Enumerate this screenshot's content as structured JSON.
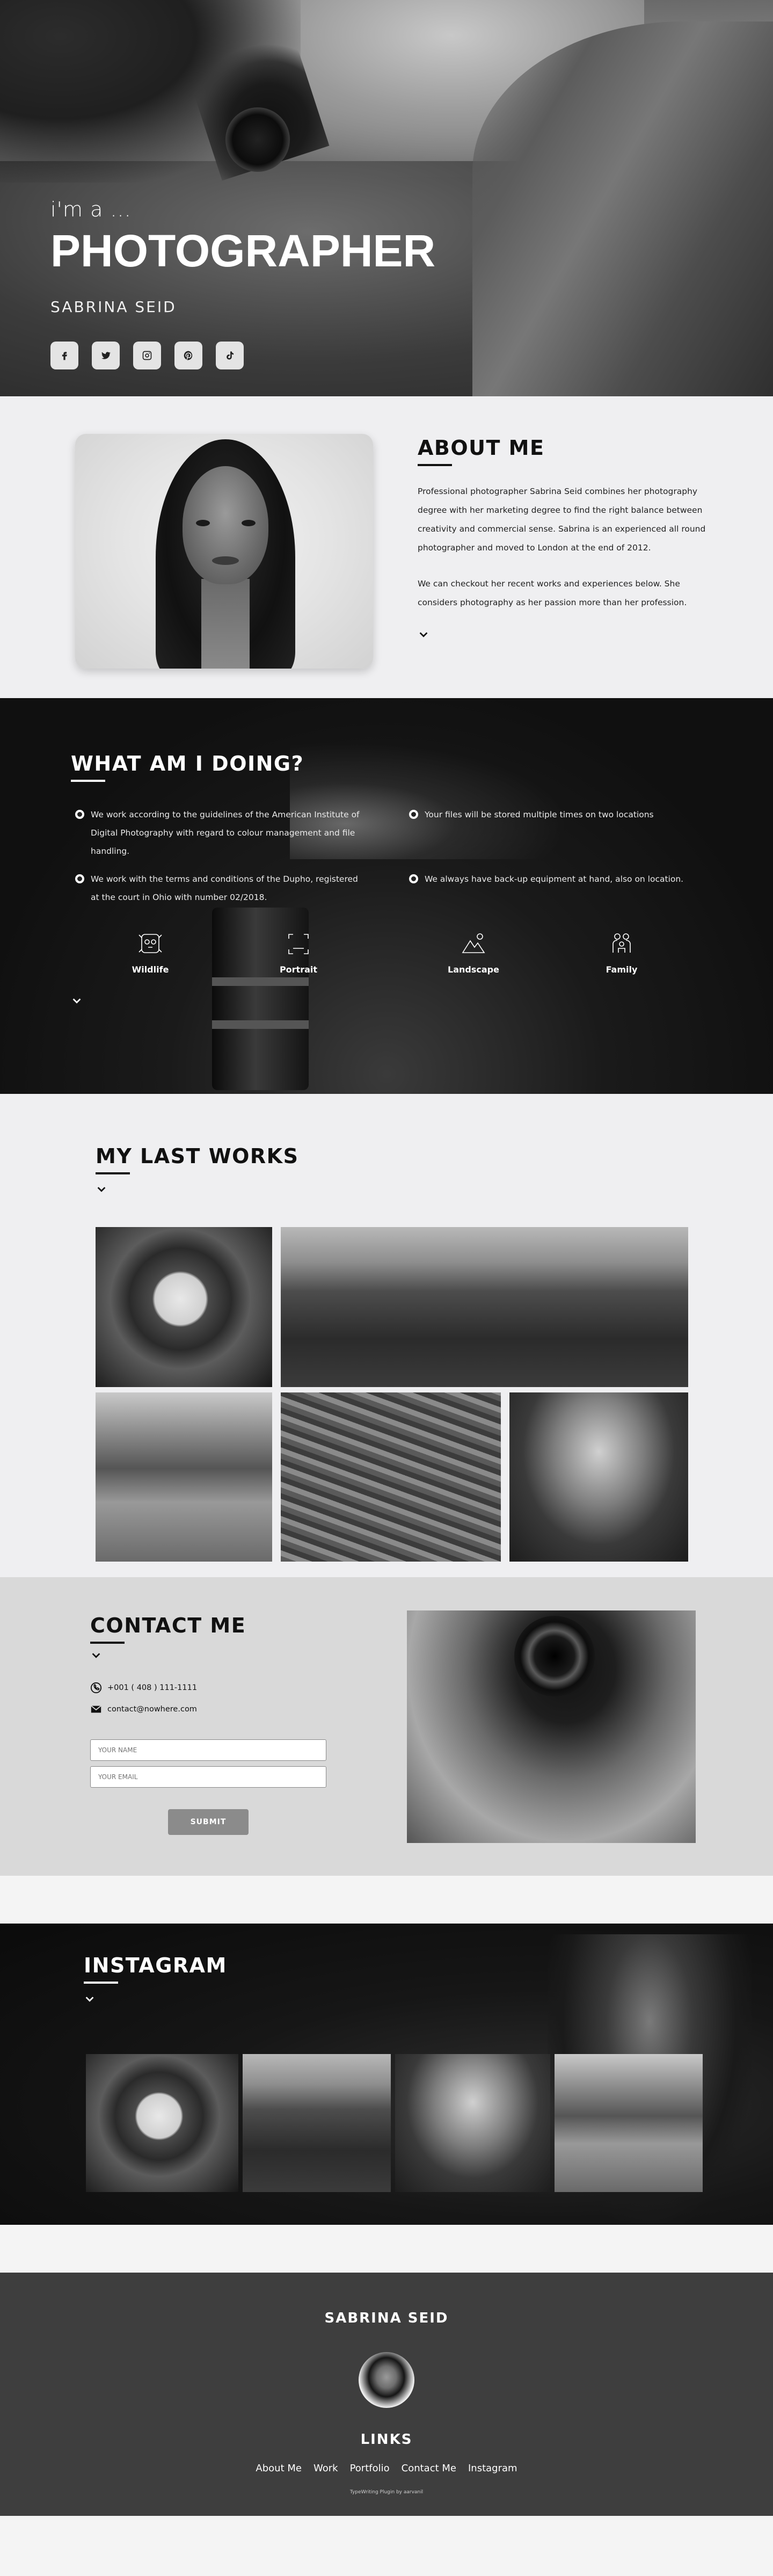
{
  "hero": {
    "tagline": "i'm a ...",
    "title": "PHOTOGRAPHER",
    "name": "SABRINA SEID",
    "socials": [
      "facebook-icon",
      "twitter-icon",
      "instagram-icon",
      "pinterest-icon",
      "tiktok-icon"
    ]
  },
  "about": {
    "heading": "ABOUT ME",
    "p1": "Professional photographer Sabrina Seid combines her photography degree with her marketing degree to find the right balance between creativity and commercial sense. Sabrina is an experienced all round photographer and moved to London at the end of 2012.",
    "p2": "We can checkout her recent works and experiences below. She considers photography as her passion more than her profession."
  },
  "doing": {
    "heading": "WHAT AM I DOING?",
    "items": [
      "We work according to the guidelines of the American Institute of Digital Photography with regard to colour management and file handling.",
      "Your files will be stored multiple times on two locations",
      "We work with the terms and conditions of the Dupho, registered at the court in Ohio with number 02/2018.",
      "We always have back-up equipment at hand, also on location."
    ],
    "categories": [
      "Wildlife",
      "Portrait",
      "Landscape",
      "Family"
    ]
  },
  "works": {
    "heading": "MY LAST WORKS"
  },
  "contact": {
    "heading": "CONTACT ME",
    "phone": "+001 ( 408 ) 111-1111",
    "email": "contact@nowhere.com",
    "name_placeholder": "YOUR NAME",
    "email_placeholder": "YOUR EMAIL",
    "submit_label": "SUBMIT"
  },
  "instagram": {
    "heading": "INSTAGRAM"
  },
  "footer": {
    "name": "SABRINA SEID",
    "links_heading": "LINKS",
    "links": [
      "About Me",
      "Work",
      "Portfolio",
      "Contact Me",
      "Instagram"
    ],
    "credit": "TypeWriting Plugin by aarvanil"
  },
  "colors": {
    "dark_section": "#101010",
    "light_section": "#efeff1",
    "contact_bg": "#d9d9d9",
    "footer_bg": "#3e3e3e",
    "button": "#8b8b8b"
  }
}
